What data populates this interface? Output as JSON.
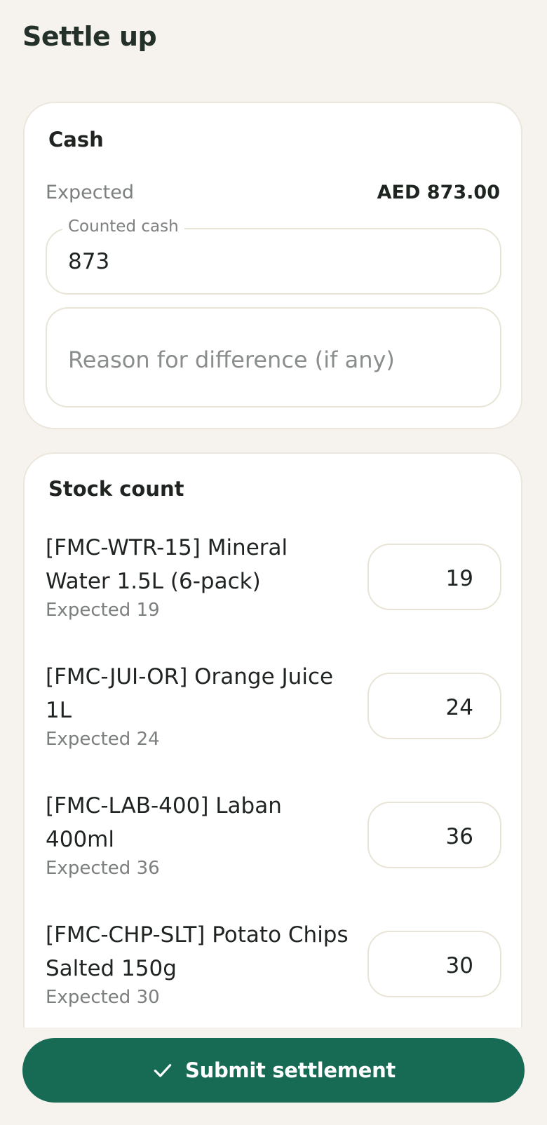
{
  "page": {
    "title": "Settle up"
  },
  "cash": {
    "title": "Cash",
    "expected_label": "Expected",
    "expected_amount": "AED 873.00",
    "counted_label": "Counted cash",
    "counted_value": "873",
    "reason_placeholder": "Reason for difference (if any)"
  },
  "stock": {
    "title": "Stock count",
    "items": [
      {
        "name": "[FMC-WTR-15] Mineral Water 1.5L (6-pack)",
        "expected": "Expected 19",
        "count": "19"
      },
      {
        "name": "[FMC-JUI-OR] Orange Juice 1L",
        "expected": "Expected 24",
        "count": "24"
      },
      {
        "name": "[FMC-LAB-400] Laban 400ml",
        "expected": "Expected 36",
        "count": "36"
      },
      {
        "name": "[FMC-CHP-SLT] Potato Chips Salted 150g",
        "expected": "Expected 30",
        "count": "30"
      }
    ]
  },
  "submit": {
    "label": "Submit settlement",
    "icon": "check-icon"
  },
  "colors": {
    "primary": "#176a54",
    "background": "#f6f3ee",
    "card": "#ffffff",
    "border": "#e8e4d6"
  }
}
